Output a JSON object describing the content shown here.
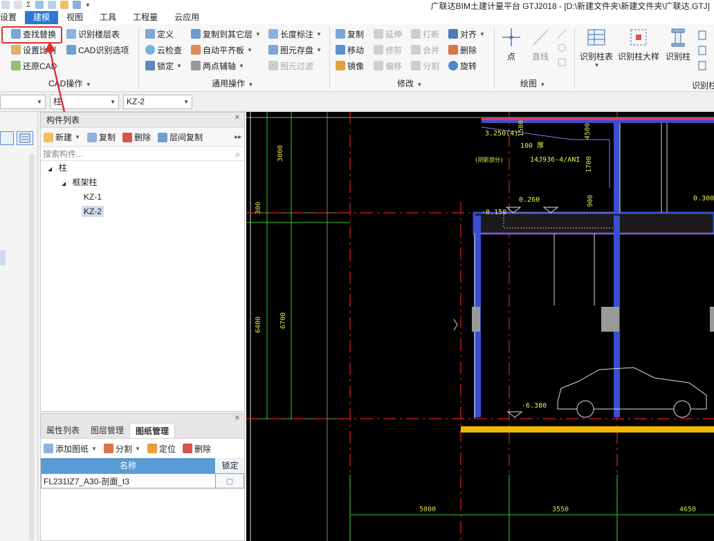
{
  "title_bar": {
    "app_title": "广联达BIM土建计量平台 GTJ2018 - [D:\\新建文件夹\\新建文件夹\\广联达.GTJ]"
  },
  "menu": {
    "tabs": [
      {
        "label": "设置"
      },
      {
        "label": "建模"
      },
      {
        "label": "视图"
      },
      {
        "label": "工具"
      },
      {
        "label": "工程量"
      },
      {
        "label": "云应用"
      }
    ],
    "active_tab": "建模"
  },
  "ribbon": {
    "cad_ops": {
      "find_replace": "查找替换",
      "recognize_floors": "识别楼层表",
      "set_scale": "设置比例",
      "cad_options": "CAD识别选项",
      "restore_cad": "还原CAD",
      "group_label": "CAD操作"
    },
    "common_ops": {
      "define": "定义",
      "copy_to_other": "复制到其它层",
      "length_mark": "长度标注",
      "cloud_check": "云检查",
      "auto_flat_slab": "自动平齐板",
      "element_save": "图元存盘",
      "lock": "锁定",
      "two_point_aux": "两点辅轴",
      "element_filter": "图元过滤",
      "group_label": "通用操作"
    },
    "modify": {
      "copy": "复制",
      "extend": "延伸",
      "break": "打断",
      "align": "对齐",
      "move": "移动",
      "trim": "修剪",
      "merge": "合并",
      "delete": "删除",
      "mirror": "镜像",
      "offset": "偏移",
      "split": "分割",
      "rotate": "旋转",
      "group_label": "修改"
    },
    "draw": {
      "point": "点",
      "line": "直线",
      "group_label": "绘图"
    },
    "recognize_column": {
      "column_table": "识别柱表",
      "column_detail": "识别柱大样",
      "column": "识别柱",
      "group_label": "识别柱"
    }
  },
  "combos": {
    "floor": "",
    "category": "柱",
    "component": "KZ-2"
  },
  "component_panel": {
    "title": "构件列表",
    "toolbar": {
      "new": "新建",
      "copy": "复制",
      "delete": "删除",
      "floor_copy": "层间复制"
    },
    "search_placeholder": "搜索构件...",
    "tree": {
      "root": "柱",
      "group": "框架柱",
      "items": [
        "KZ-1",
        "KZ-2"
      ],
      "selected": "KZ-2"
    }
  },
  "lower_panel": {
    "tabs": [
      "属性列表",
      "图层管理",
      "图纸管理"
    ],
    "active_tab": "图纸管理",
    "toolbar": {
      "add_drawing": "添加图纸",
      "split": "分割",
      "locate": "定位",
      "delete": "删除"
    },
    "columns": [
      "名称",
      "锁定"
    ],
    "rows": [
      {
        "name": "FL231IZ7_A30-剖面_t3",
        "locked": "🔒"
      }
    ]
  },
  "cad_texts": {
    "dim_3000": "3000",
    "dim_300": "300",
    "dim_6400": "6400",
    "dim_6700": "6700",
    "dim_1500": "1500",
    "dim_4500": "4500",
    "dim_1700": "1700",
    "dim_900": "900",
    "lvl_3250": "3.250(4)",
    "note_100": "100 厚",
    "note_spec": "14J936-4/ANI",
    "note_left": "(阴影部分)",
    "lvl_0260": "0.260",
    "lvl_0150": "-0.150",
    "lvl_0300": "0.300",
    "lvl_6380": "-6.380",
    "dim_5000": "5000",
    "dim_3550": "3550",
    "dim_4650": "4650"
  },
  "colors": {
    "accent": "#2b79d1",
    "highlight": "#e03030",
    "cad_bg": "#000000",
    "table_header": "#5b9bd5"
  }
}
